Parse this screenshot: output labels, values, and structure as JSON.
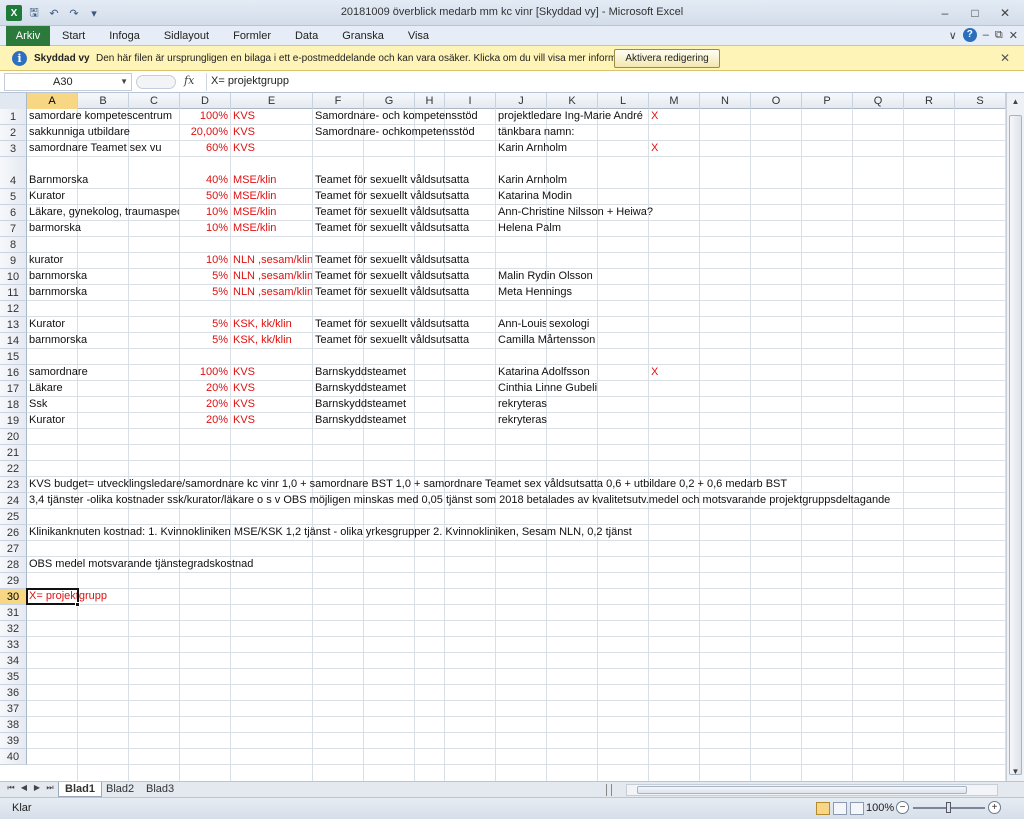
{
  "window": {
    "title": "20181009  överblick medarb mm kc vinr  [Skyddad vy]  -  Microsoft Excel"
  },
  "ribbon": {
    "file_tab": "Arkiv",
    "tabs": [
      "Start",
      "Infoga",
      "Sidlayout",
      "Formler",
      "Data",
      "Granska",
      "Visa"
    ]
  },
  "message_bar": {
    "title": "Skyddad vy",
    "text": "Den här filen är ursprungligen en bilaga i ett e-postmeddelande och kan vara osäker. Klicka om du vill visa mer information.",
    "button": "Aktivera redigering"
  },
  "formula_bar": {
    "name_box": "A30",
    "formula": "X= projektgrupp"
  },
  "columns": [
    "A",
    "B",
    "C",
    "D",
    "E",
    "F",
    "G",
    "H",
    "I",
    "J",
    "K",
    "L",
    "M",
    "N",
    "O",
    "P",
    "Q",
    "R",
    "S"
  ],
  "rows": [
    "1",
    "2",
    "3",
    "4",
    "5",
    "6",
    "7",
    "8",
    "9",
    "10",
    "11",
    "12",
    "13",
    "14",
    "15",
    "16",
    "17",
    "18",
    "19",
    "20",
    "21",
    "22",
    "23",
    "24",
    "25",
    "26",
    "27",
    "28",
    "29",
    "30",
    "31",
    "32",
    "33",
    "34",
    "35",
    "36",
    "37",
    "38",
    "39",
    "40"
  ],
  "cells": {
    "r1": {
      "a": "samordare kompetescentrum",
      "d": "100%",
      "e": "KVS",
      "f": "Samordnare- och kompetensstöd",
      "j": "projektledare Ing-Marie André",
      "m": "X"
    },
    "r2": {
      "a": "sakkunniga utbildare",
      "d": "20,00%",
      "e": "KVS",
      "f": "Samordnare- ochkompetensstöd",
      "j": "tänkbara namn:"
    },
    "r3": {
      "a": "samordnare Teamet sex vu",
      "d": "60%",
      "e": "KVS",
      "j": "Karin Arnholm",
      "m": "X"
    },
    "r4": {
      "a": "Barnmorska",
      "d": "40%",
      "e": "MSE/klin",
      "f": "Teamet för sexuellt våldsutsatta",
      "j": "Karin Arnholm"
    },
    "r5": {
      "a": "Kurator",
      "d": "50%",
      "e": "MSE/klin",
      "f": "Teamet för sexuellt våldsutsatta",
      "j": "Katarina Modin"
    },
    "r6": {
      "a": "Läkare, gynekolog, traumaspec",
      "d": "10%",
      "e": "MSE/klin",
      "f": "Teamet för sexuellt våldsutsatta",
      "j": "Ann-Christine Nilsson +  Heiwa?"
    },
    "r7": {
      "a": "barmorska",
      "d": "10%",
      "e": "MSE/klin",
      "f": "Teamet för sexuellt våldsutsatta",
      "j": "Helena Palm"
    },
    "r9": {
      "a": "kurator",
      "d": "10%",
      "e": "NLN ,sesam/klin",
      "f": "Teamet för sexuellt våldsutsatta"
    },
    "r10": {
      "a": "barnmorska",
      "d": "5%",
      "e": "NLN ,sesam/klin",
      "f": "Teamet för sexuellt våldsutsatta",
      "j": "Malin Rydin Olsson"
    },
    "r11": {
      "a": "barnmorska",
      "d": "5%",
      "e": "NLN ,sesam/klin",
      "f": "Teamet för sexuellt våldsutsatta",
      "j": "Meta Hennings"
    },
    "r13": {
      "a": "Kurator",
      "d": "5%",
      "e": "KSK, kk/klin",
      "f": "Teamet för sexuellt våldsutsatta",
      "j": "Ann-Louise Larsson",
      "k": "sexologi"
    },
    "r14": {
      "a": "barnmorska",
      "d": "5%",
      "e": "KSK, kk/klin",
      "f": "Teamet för sexuellt våldsutsatta",
      "j": "Camilla Mårtensson"
    },
    "r16": {
      "a": "samordnare",
      "d": "100%",
      "e": "KVS",
      "f": "Barnskyddsteamet",
      "j": "Katarina Adolfsson",
      "m": "X"
    },
    "r17": {
      "a": "Läkare",
      "d": "20%",
      "e": "KVS",
      "f": "Barnskyddsteamet",
      "j": "Cinthia Linne Gubeli"
    },
    "r18": {
      "a": "Ssk",
      "d": "20%",
      "e": "KVS",
      "f": "Barnskyddsteamet",
      "j": "rekryteras"
    },
    "r19": {
      "a": "Kurator",
      "d": "20%",
      "e": "KVS",
      "f": "Barnskyddsteamet",
      "j": "rekryteras"
    },
    "r23": {
      "a": "KVS budget= utvecklingsledare/samordnare kc vinr 1,0 + samordnare BST 1,0 + samordnare Teamet sex våldsutsatta 0,6 + utbildare 0,2 + 0,6 medarb BST"
    },
    "r24": {
      "a": " 3,4 tjänster -olika kostnader ssk/kurator/läkare o s v  OBS möjligen minskas med 0,05 tjänst som 2018 betalades av kvalitetsutv.medel och motsvarande projektgruppsdeltagande"
    },
    "r26": {
      "a": "Klinikanknuten kostnad: 1. Kvinnokliniken MSE/KSK 1,2 tjänst - olika yrkesgrupper 2. Kvinnokliniken, Sesam NLN, 0,2 tjänst"
    },
    "r28": {
      "a": "OBS medel motsvarande tjänstegradskostnad"
    },
    "r30": {
      "a": "X= projektgrupp"
    }
  },
  "sheets": [
    "Blad1",
    "Blad2",
    "Blad3"
  ],
  "status": {
    "text": "Klar",
    "zoom": "100%"
  }
}
